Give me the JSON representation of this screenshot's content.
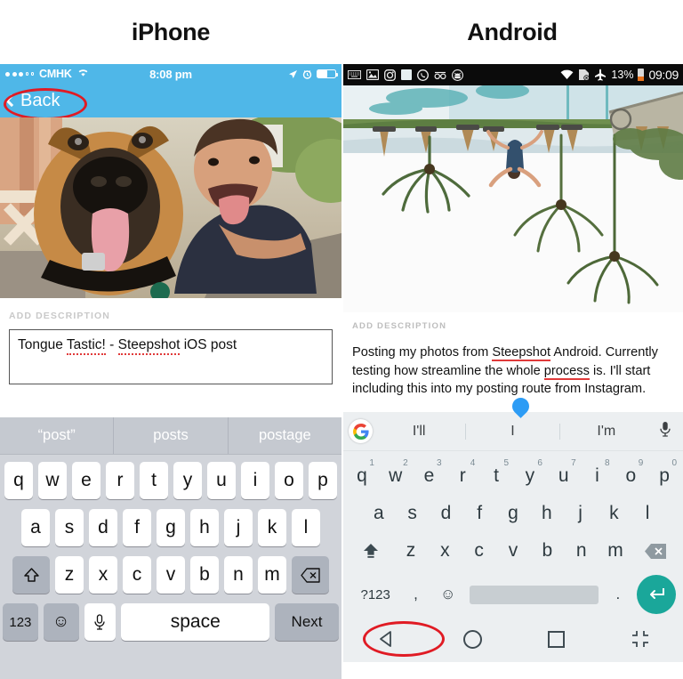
{
  "headers": {
    "ios": "iPhone",
    "android": "Android"
  },
  "colors": {
    "ios_bar": "#4fb7e8",
    "android_status_bar": "#0b0b0b",
    "annotation_red": "#e01b24",
    "android_enter_teal": "#1aa79a",
    "android_cursor_blue": "#2d9cf5",
    "spellcheck_red": "#e03a3a"
  },
  "ios": {
    "status": {
      "carrier": "CMHK",
      "signal_dots_filled": 3,
      "signal_dots_total": 5,
      "wifi_icon": "wifi-icon",
      "time": "8:08 pm",
      "location_icon": "location-arrow-icon",
      "alarm_icon": "alarm-clock-icon",
      "battery_icon": "battery-icon",
      "battery_level_pct": 55
    },
    "nav": {
      "back_label": "Back",
      "back_chevron_icon": "chevron-left-icon"
    },
    "photo_alt": "selfie of man and german shepherd dog with tongues out",
    "form": {
      "label": "ADD DESCRIPTION",
      "description_value": "Tongue Tastic! - Steepshot iOS post",
      "misspelled_words": [
        "Tastic!",
        "Steepshot"
      ]
    },
    "keyboard": {
      "suggestions": [
        "“post”",
        "posts",
        "postage"
      ],
      "row1": [
        "q",
        "w",
        "e",
        "r",
        "t",
        "y",
        "u",
        "i",
        "o",
        "p"
      ],
      "row2": [
        "a",
        "s",
        "d",
        "f",
        "g",
        "h",
        "j",
        "k",
        "l"
      ],
      "row3": [
        "z",
        "x",
        "c",
        "v",
        "b",
        "n",
        "m"
      ],
      "shift_icon": "shift-arrow-icon",
      "delete_icon": "backspace-icon",
      "numeric_label": "123",
      "emoji_icon": "smiley-face-icon",
      "mic_icon": "microphone-icon",
      "space_label": "space",
      "next_label": "Next"
    }
  },
  "android": {
    "status": {
      "left_icons": [
        "keyboard-icon",
        "photo-icon",
        "instagram-icon",
        "square-app-icon",
        "whatsapp-icon",
        "glasses-icon",
        "android-head-icon"
      ],
      "wifi_icon": "wifi-icon",
      "sdcard_icon": "sdcard-error-icon",
      "airplane_icon": "airplane-mode-icon",
      "battery_percent": "13%",
      "battery_icon": "battery-icon",
      "time": "09:09"
    },
    "photo_alt": "upside-down beach scene with palm trees, thatched umbrellas and a jumping person",
    "form": {
      "label": "ADD DESCRIPTION",
      "description_value": "Posting my photos from Steepshot Android. Currently testing how streamline the whole process is. I'll start including this into my posting route from Instagram.",
      "description_parts": [
        "Posting my photos from ",
        "Steepshot",
        " Android. Currently testing how streamline the whole ",
        "process",
        " is. I'll start including this into my posting route from Instagram."
      ],
      "misspelled_words": [
        "Steepshot",
        "process"
      ],
      "cursor_handle_icon": "text-cursor-handle-icon"
    },
    "keyboard": {
      "google_logo": "google-g-icon",
      "suggestions": [
        "I'll",
        "I",
        "I'm"
      ],
      "mic_icon": "microphone-icon",
      "row1": [
        "q",
        "w",
        "e",
        "r",
        "t",
        "y",
        "u",
        "i",
        "o",
        "p"
      ],
      "row1_numbers": [
        "1",
        "2",
        "3",
        "4",
        "5",
        "6",
        "7",
        "8",
        "9",
        "0"
      ],
      "row2": [
        "a",
        "s",
        "d",
        "f",
        "g",
        "h",
        "j",
        "k",
        "l"
      ],
      "row3": [
        "z",
        "x",
        "c",
        "v",
        "b",
        "n",
        "m"
      ],
      "shift_icon": "shift-arrow-icon",
      "delete_icon": "backspace-icon",
      "symbols_label": "?123",
      "comma_label": ",",
      "emoji_icon": "smiley-face-icon",
      "period_label": ".",
      "enter_icon": "enter-return-icon"
    },
    "navbar": {
      "back_icon": "back-triangle-icon",
      "home_icon": "home-circle-icon",
      "recents_icon": "recents-square-icon",
      "collapse_icon": "collapse-arrows-icon"
    }
  },
  "annotations": {
    "ios_circle_target": "Back",
    "android_circle_target": "back-triangle-icon"
  }
}
